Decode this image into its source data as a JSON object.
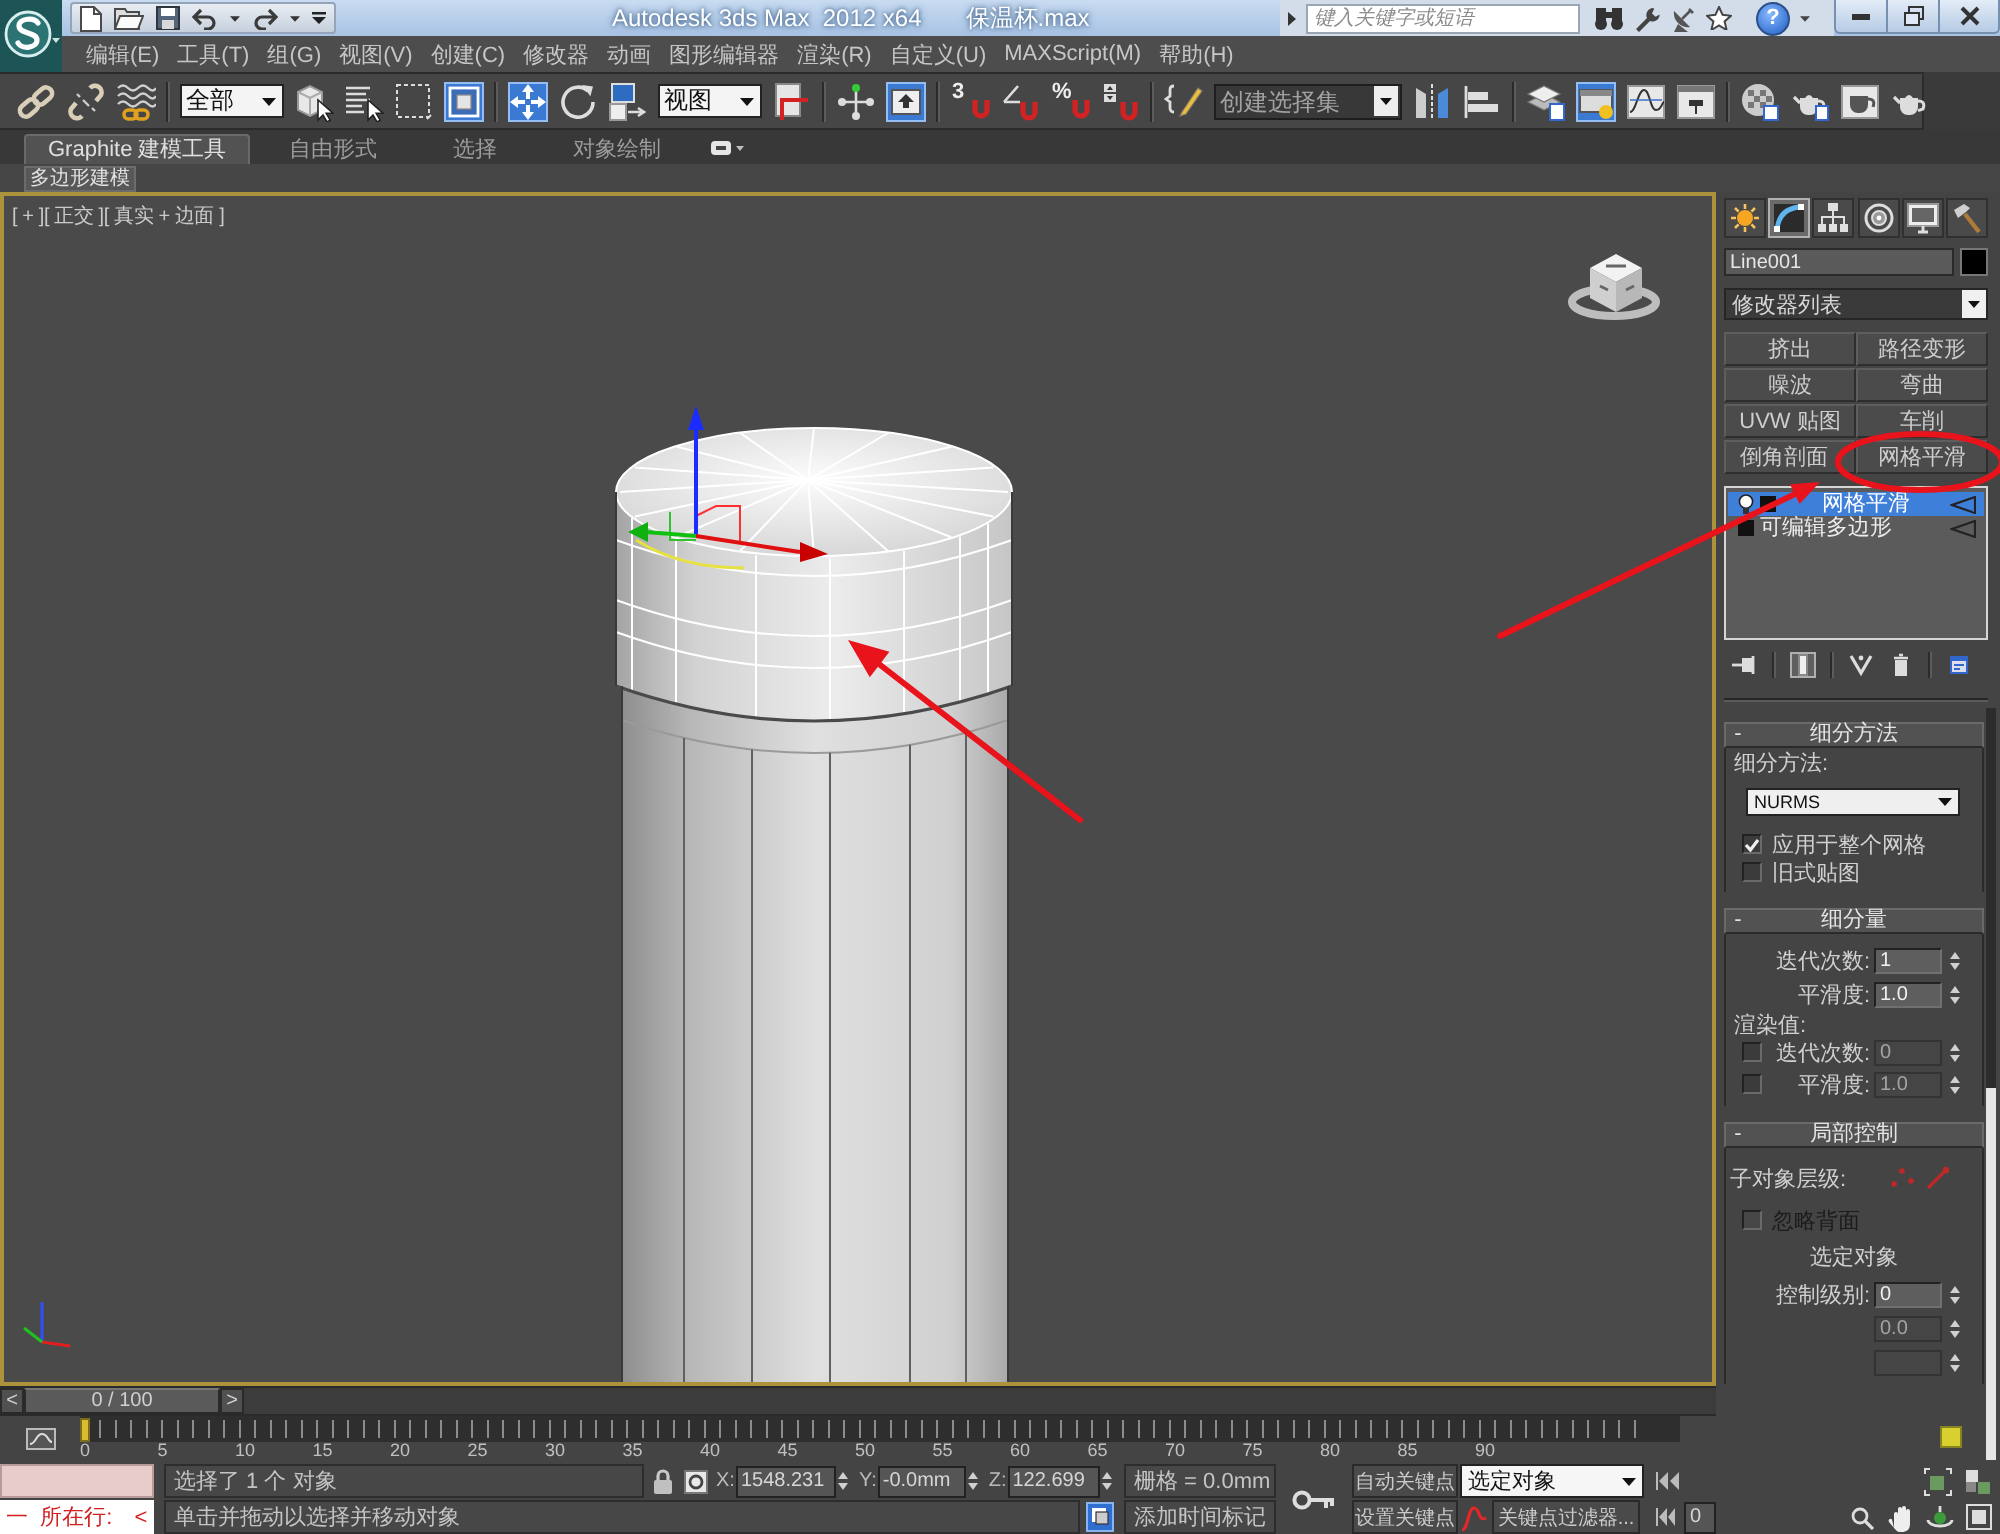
{
  "title_bar": {
    "app_title": "Autodesk 3ds Max  2012 x64",
    "file_name": "保温杯.max",
    "search": {
      "placeholder": "键入关键字或短语"
    },
    "help": "?"
  },
  "menu_bar": [
    "编辑(E)",
    "工具(T)",
    "组(G)",
    "视图(V)",
    "创建(C)",
    "修改器",
    "动画",
    "图形编辑器",
    "渲染(R)",
    "自定义(U)",
    "MAXScript(M)",
    "帮助(H)"
  ],
  "main_toolbar": [
    {
      "kind": "tool",
      "selected": false
    },
    {
      "kind": "tool",
      "selected": false
    },
    {
      "kind": "tool",
      "selected": false
    },
    {
      "kind": "separator"
    },
    {
      "kind": "dropdown",
      "value": "全部"
    },
    {
      "kind": "tool",
      "selected": false
    },
    {
      "kind": "tool",
      "selected": false
    },
    {
      "kind": "tool",
      "selected": false
    },
    {
      "kind": "tool",
      "selected": true
    },
    {
      "kind": "separator"
    },
    {
      "kind": "tool",
      "selected": true
    },
    {
      "kind": "tool",
      "selected": false
    },
    {
      "kind": "tool",
      "selected": false
    },
    {
      "kind": "dropdown",
      "value": "视图"
    },
    {
      "kind": "tool",
      "selected": false
    },
    {
      "kind": "separator"
    },
    {
      "kind": "tool",
      "selected": false
    },
    {
      "kind": "tool",
      "selected": true
    },
    {
      "kind": "separator"
    },
    {
      "kind": "snap",
      "text": "3",
      "selected": false
    },
    {
      "kind": "tool",
      "selected": false
    },
    {
      "kind": "snap",
      "text": "%",
      "selected": false
    },
    {
      "kind": "tool",
      "selected": false
    },
    {
      "kind": "separator"
    },
    {
      "kind": "tool",
      "selected": false
    },
    {
      "kind": "combo",
      "placeholder": "创建选择集"
    },
    {
      "kind": "tool",
      "selected": false
    },
    {
      "kind": "tool",
      "selected": false
    },
    {
      "kind": "separator"
    },
    {
      "kind": "tool",
      "selected": false
    },
    {
      "kind": "tool",
      "selected": true
    },
    {
      "kind": "tool",
      "selected": false
    },
    {
      "kind": "tool",
      "selected": false
    },
    {
      "kind": "separator"
    },
    {
      "kind": "tool",
      "selected": false
    },
    {
      "kind": "tool",
      "selected": false
    },
    {
      "kind": "tool",
      "selected": false
    },
    {
      "kind": "tool",
      "selected": false
    }
  ],
  "ribbon": {
    "tabs": [
      {
        "label": "Graphite 建模工具",
        "selected": true
      },
      {
        "label": "自由形式",
        "selected": false
      },
      {
        "label": "选择",
        "selected": false
      },
      {
        "label": "对象绘制",
        "selected": false
      }
    ],
    "panel_button": "多边形建模"
  },
  "viewport": {
    "label": "[ + ][ 正交 ][ 真实 + 边面 ]",
    "active": true
  },
  "time_slider": {
    "previous": "<",
    "position": "0 / 100",
    "next": ">",
    "level": 0
  },
  "track_bar": {
    "frame_labels": [
      "0",
      "5",
      "10",
      "15",
      "20",
      "25",
      "30",
      "35",
      "40",
      "45",
      "50",
      "55",
      "60",
      "65",
      "70",
      "75",
      "80",
      "85",
      "90"
    ]
  },
  "command_panel": {
    "tabs": [
      {
        "selected": false
      },
      {
        "selected": true
      },
      {
        "selected": false
      },
      {
        "selected": false
      },
      {
        "selected": false
      },
      {
        "selected": false
      }
    ],
    "object_name": "Line001",
    "modifier_list": "修改器列表",
    "modifier_buttons": [
      "挤出",
      "路径变形",
      "噪波",
      "弯曲",
      "UVW 贴图",
      "车削",
      "倒角剖面",
      "网格平滑"
    ],
    "stack": [
      {
        "kind": "modifier",
        "label": "网格平滑",
        "selected": true,
        "on": true
      },
      {
        "kind": "object",
        "label": "可编辑多边形",
        "selected": false
      }
    ],
    "stack_tools": [
      {
        "selected": false
      },
      {
        "selected": true
      },
      {
        "selected": false
      },
      {
        "selected": false
      },
      {
        "selected": false
      }
    ],
    "rollouts": [
      {
        "toggle": "-",
        "title": "细分方法",
        "rows": [
          {
            "kind": "label",
            "text": "细分方法:"
          },
          {
            "kind": "dropdown",
            "value": "NURMS"
          },
          {
            "kind": "checkbox",
            "label": "应用于整个网格",
            "checked": true,
            "disabled": false
          },
          {
            "kind": "checkbox",
            "label": "旧式贴图",
            "checked": false,
            "disabled": false
          }
        ]
      },
      {
        "toggle": "-",
        "title": "细分量",
        "rows": [
          {
            "kind": "spinner",
            "label": "迭代次数:",
            "value": "1",
            "disabled": false
          },
          {
            "kind": "spinner",
            "label": "平滑度:",
            "value": "1.0",
            "disabled": false
          },
          {
            "kind": "label",
            "text": "渲染值:"
          },
          {
            "kind": "check_spinner",
            "checked": false,
            "label": "迭代次数:",
            "value": "0",
            "disabled": true
          },
          {
            "kind": "check_spinner",
            "checked": false,
            "label": "平滑度:",
            "value": "1.0",
            "disabled": true
          }
        ]
      },
      {
        "toggle": "-",
        "title": "局部控制",
        "rows": [
          {
            "kind": "subobject",
            "label": "子对象层级:"
          },
          {
            "kind": "checkbox",
            "label": "忽略背面",
            "checked": false,
            "disabled": true
          },
          {
            "kind": "center_label",
            "text": "选定对象"
          },
          {
            "kind": "spinner",
            "label": "控制级别:",
            "value": "0",
            "disabled": false
          },
          {
            "kind": "spinner",
            "value": "0.0",
            "disabled": true
          },
          {
            "kind": "spinner",
            "disabled": true
          }
        ]
      }
    ]
  },
  "status_bar": {
    "listener": {
      "input": "一  所在行:",
      "arrow": "<"
    },
    "selection_info": "选择了 1 个 对象",
    "coordinates": [
      {
        "axis": "X:",
        "value": "1548.231"
      },
      {
        "axis": "Y:",
        "value": "-0.0mm"
      },
      {
        "axis": "Z:",
        "value": "122.699"
      }
    ],
    "grid": "栅格 = 0.0mm",
    "prompt": "单击并拖动以选择并移动对象",
    "time_tag": "添加时间标记",
    "auto_key": {
      "label": "自动关键点",
      "on": false
    },
    "set_key": "设置关键点",
    "key_mode": "选定对象",
    "key_filters": "关键点过滤器...",
    "frame": "0"
  }
}
